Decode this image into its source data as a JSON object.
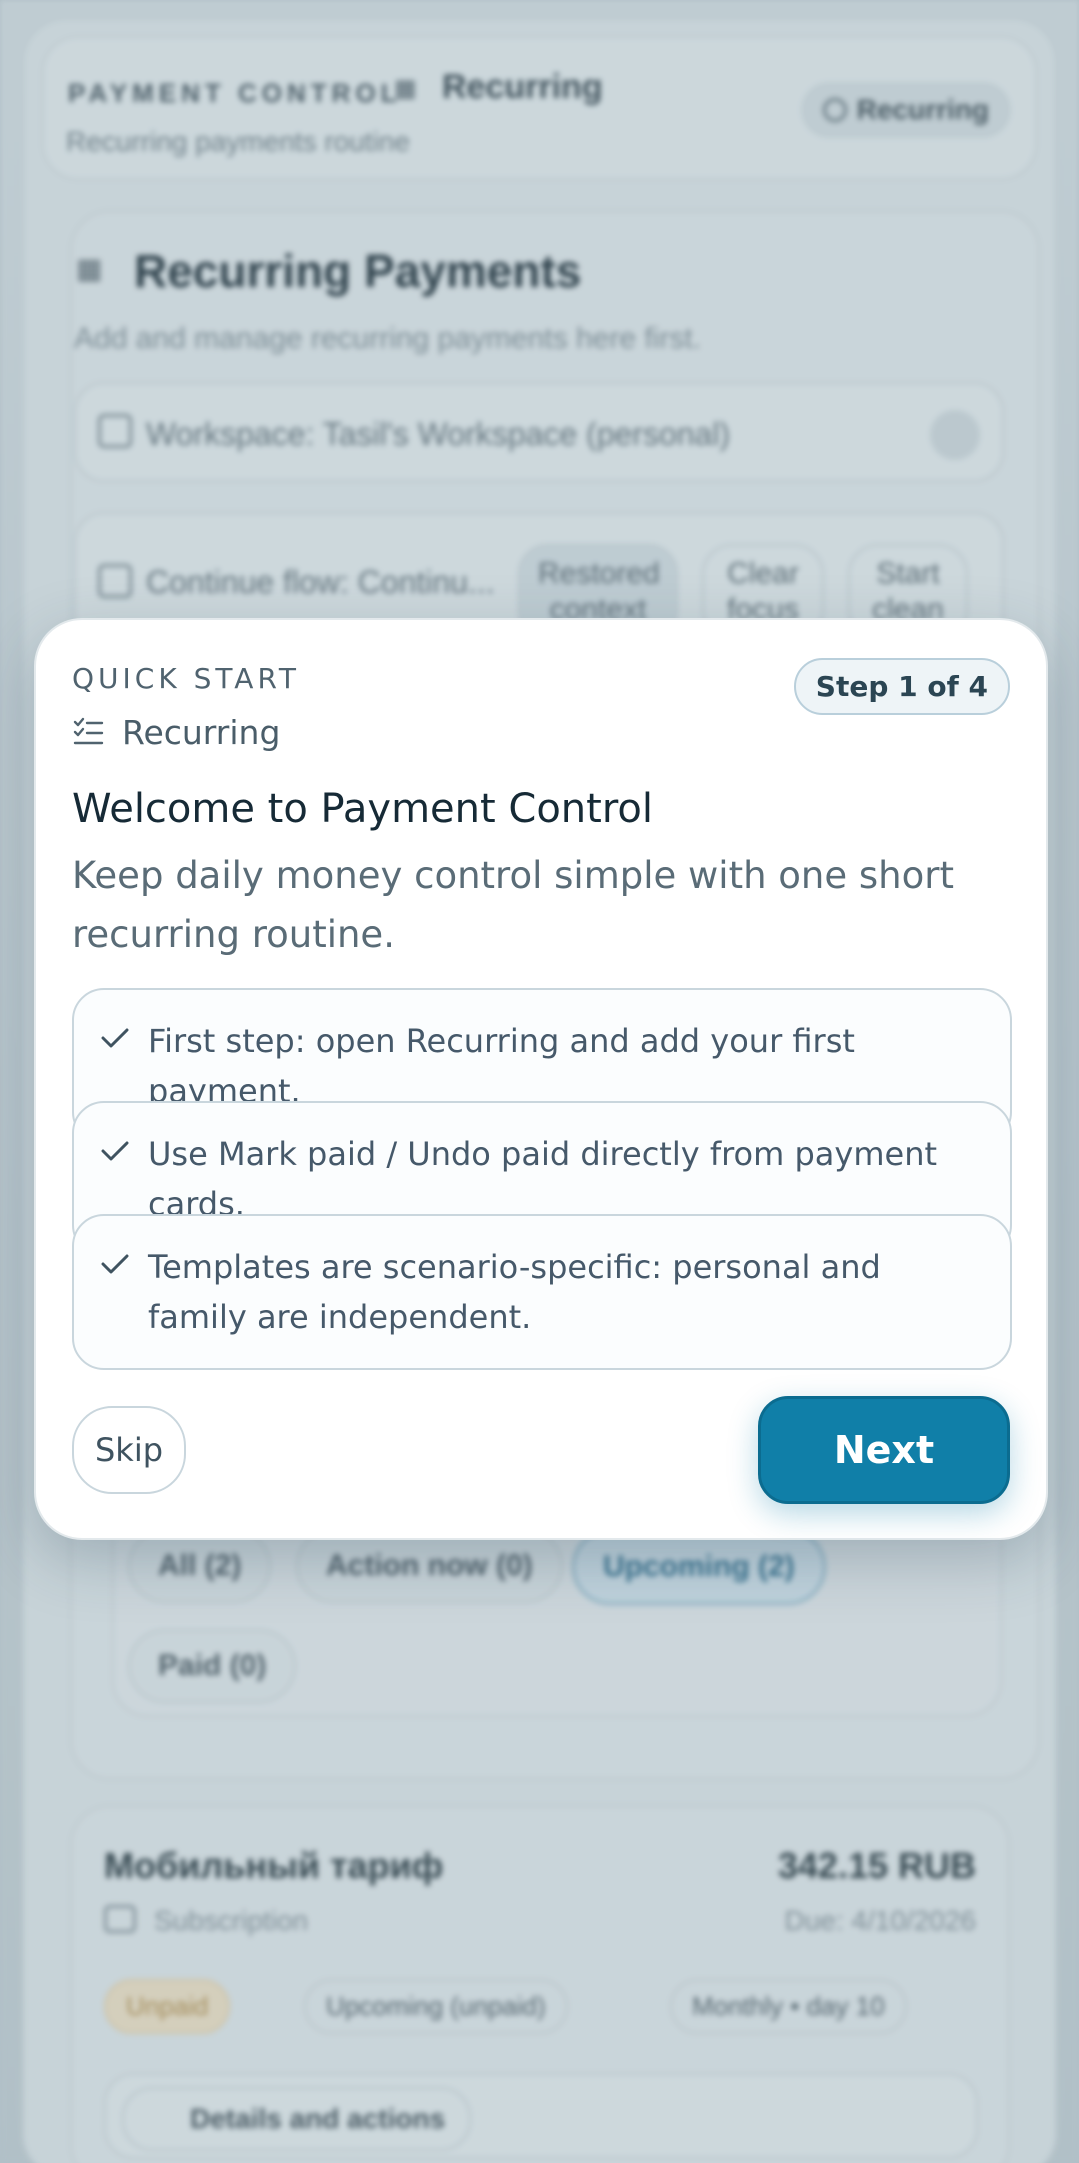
{
  "background": {
    "header": {
      "brand": "PAYMENT CONTROL",
      "section": "Recurring",
      "subtitle": "Recurring payments routine",
      "chip": "Recurring"
    },
    "main": {
      "title": "Recurring Payments",
      "subtitle": "Add and manage recurring payments here first.",
      "workspace": "Workspace: Tasil's Workspace (personal)",
      "flow": "Continue flow: Continu...",
      "flow_chips": [
        "Restored context",
        "Clear focus",
        "Start clean"
      ]
    },
    "filters": [
      {
        "label": "All (2)",
        "active": false
      },
      {
        "label": "Action now (0)",
        "active": false
      },
      {
        "label": "Upcoming (2)",
        "active": true
      },
      {
        "label": "Paid (0)",
        "active": false
      }
    ],
    "payment_card": {
      "title": "Мобильный тариф",
      "amount": "342.15 RUB",
      "type": "Subscription",
      "due": "Due: 4/10/2026",
      "chips": [
        "Unpaid",
        "Upcoming (unpaid)",
        "Monthly • day 10"
      ],
      "actions_label": "Details and actions"
    }
  },
  "modal": {
    "eyebrow": "QUICK START",
    "section": "Recurring",
    "step": "Step 1 of 4",
    "title": "Welcome to Payment Control",
    "description": "Keep daily money control simple with one short recurring routine.",
    "tips": [
      "First step: open Recurring and add your first payment.",
      "Use Mark paid / Undo paid directly from payment cards.",
      "Templates are scenario-specific: personal and family are independent."
    ],
    "skip_label": "Skip",
    "next_label": "Next",
    "accent_color": "#107fa8"
  }
}
